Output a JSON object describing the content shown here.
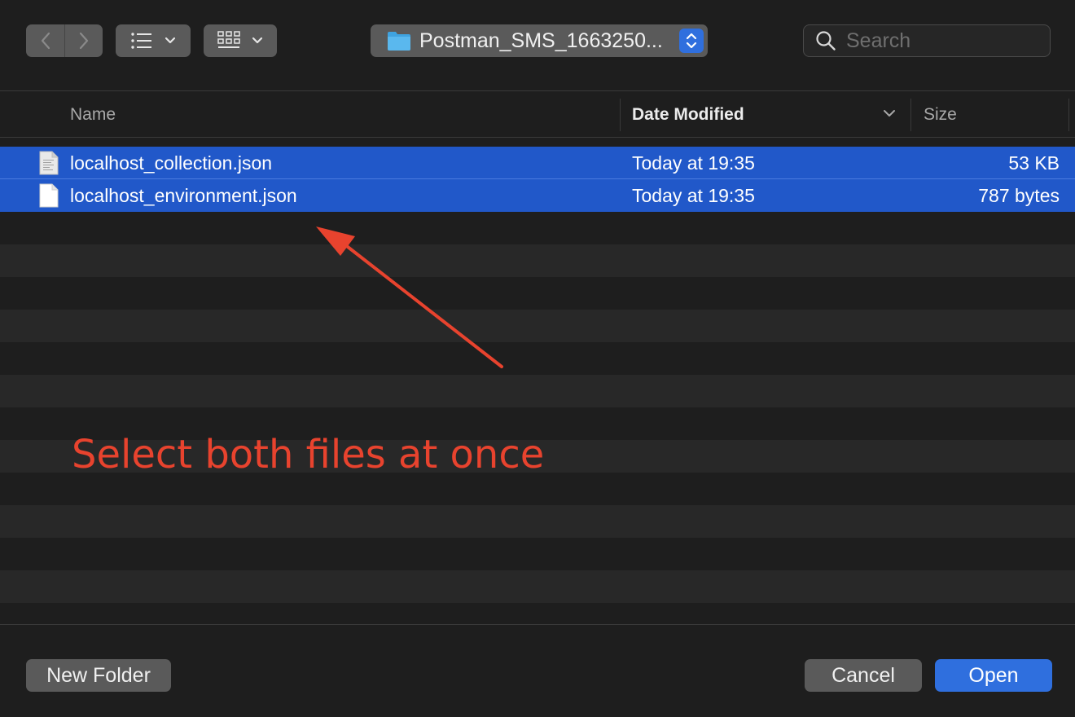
{
  "toolbar": {
    "path_label": "Postman_SMS_1663250...",
    "search_placeholder": "Search"
  },
  "columns": {
    "name": "Name",
    "date_modified": "Date Modified",
    "size": "Size"
  },
  "files": [
    {
      "name": "localhost_collection.json",
      "date": "Today at 19:35",
      "size": "53 KB",
      "selected": true
    },
    {
      "name": "localhost_environment.json",
      "date": "Today at 19:35",
      "size": "787 bytes",
      "selected": true
    }
  ],
  "annotation": {
    "text": "Select both files at once",
    "color": "#e8432e"
  },
  "footer": {
    "new_folder_label": "New Folder",
    "cancel_label": "Cancel",
    "open_label": "Open"
  },
  "colors": {
    "background": "#1e1e1e",
    "selection": "#2158c9",
    "accent": "#2f6fde"
  }
}
